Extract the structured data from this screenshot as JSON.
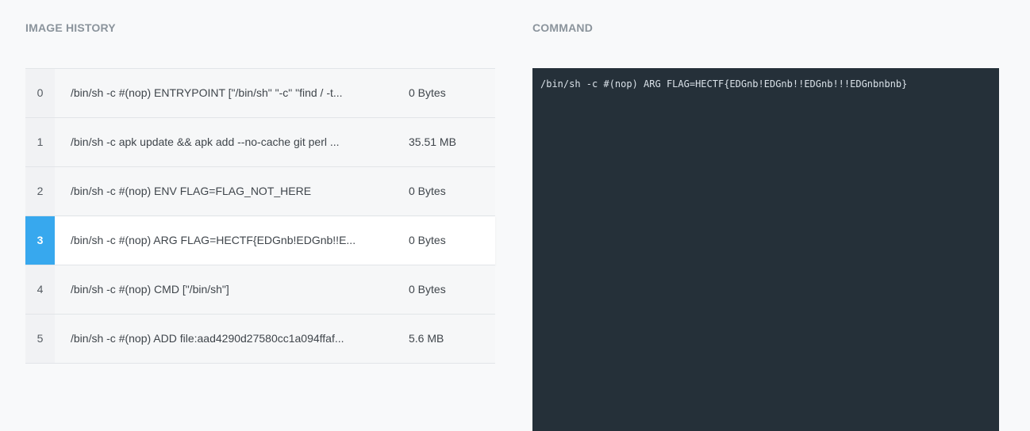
{
  "headings": {
    "history": "IMAGE HISTORY",
    "command": "COMMAND"
  },
  "history": [
    {
      "index": "0",
      "command": "/bin/sh -c #(nop) ENTRYPOINT [\"/bin/sh\" \"-c\" \"find / -t...",
      "size": "0 Bytes"
    },
    {
      "index": "1",
      "command": "/bin/sh -c apk update && apk add --no-cache git perl ...",
      "size": "35.51 MB"
    },
    {
      "index": "2",
      "command": "/bin/sh -c #(nop) ENV FLAG=FLAG_NOT_HERE",
      "size": "0 Bytes"
    },
    {
      "index": "3",
      "command": "/bin/sh -c #(nop) ARG FLAG=HECTF{EDGnb!EDGnb!!E...",
      "size": "0 Bytes"
    },
    {
      "index": "4",
      "command": "/bin/sh -c #(nop) CMD [\"/bin/sh\"]",
      "size": "0 Bytes"
    },
    {
      "index": "5",
      "command": "/bin/sh -c #(nop) ADD file:aad4290d27580cc1a094ffaf...",
      "size": "5.6 MB"
    }
  ],
  "selected_index": 3,
  "command_text": "/bin/sh -c #(nop) ARG FLAG=HECTF{EDGnb!EDGnb!!EDGnb!!!EDGnbnbnb}",
  "colors": {
    "accent": "#37a8ee",
    "command_bg": "#253039",
    "page_bg": "#f8f9fa"
  }
}
